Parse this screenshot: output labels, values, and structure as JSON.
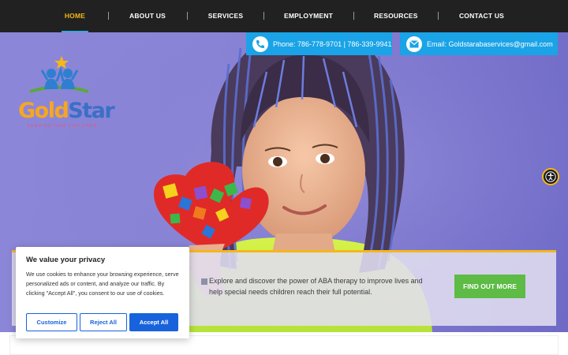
{
  "nav": {
    "items": [
      {
        "label": "HOME",
        "active": true
      },
      {
        "label": "ABOUT US",
        "active": false
      },
      {
        "label": "SERVICES",
        "active": false
      },
      {
        "label": "EMPLOYMENT",
        "active": false
      },
      {
        "label": "RESOURCES",
        "active": false
      },
      {
        "label": "CONTACT US",
        "active": false
      }
    ]
  },
  "contact": {
    "phone": "Phone: 786-778-9701 | 786-339-9941",
    "email": "Email: Goldstarabaservices@gmail.com"
  },
  "logo": {
    "word_part1": "Gold",
    "word_part2": "Star",
    "tagline": "SERVING OUR CHILDREN"
  },
  "banner": {
    "text": "Explore and discover the power of ABA therapy to improve lives and help special needs children reach their full potential.",
    "button_label": "FIND OUT MORE"
  },
  "cookie": {
    "title": "We value your privacy",
    "body": "We use cookies to enhance your browsing experience, serve personalized ads or content, and analyze our traffic. By clicking \"Accept All\", you consent to our use of cookies.",
    "customize_label": "Customize",
    "reject_label": "Reject All",
    "accept_label": "Accept All"
  },
  "icons": {
    "phone": "phone-icon",
    "email": "envelope-icon",
    "accessibility": "accessibility-icon"
  },
  "colors": {
    "nav_bg": "#212121",
    "nav_active": "#f5b71a",
    "contact_blue": "#1aa3e6",
    "hero_purple": "#8a84d6",
    "cta_green": "#5dbb46",
    "cookie_blue": "#1863dc",
    "banner_accent": "#f5b71a"
  }
}
